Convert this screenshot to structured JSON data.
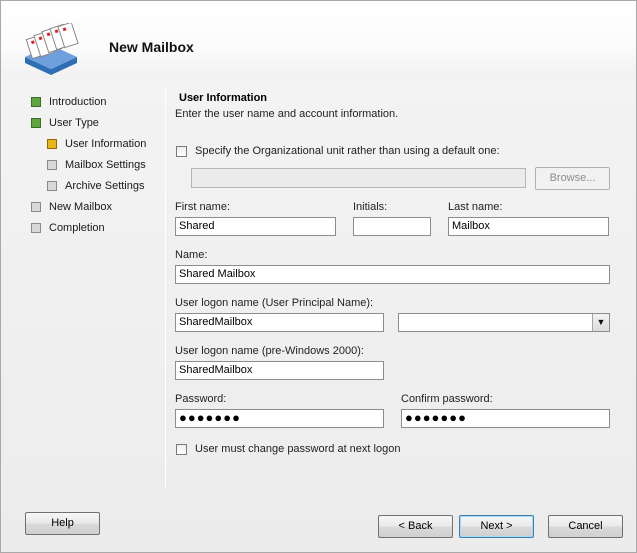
{
  "window": {
    "title": "New Mailbox"
  },
  "nav": {
    "items": [
      {
        "label": "Introduction",
        "state": "done"
      },
      {
        "label": "User Type",
        "state": "done"
      },
      {
        "label": "User Information",
        "state": "current"
      },
      {
        "label": "Mailbox Settings",
        "state": "pending"
      },
      {
        "label": "Archive Settings",
        "state": "pending"
      },
      {
        "label": "New Mailbox",
        "state": "pending"
      },
      {
        "label": "Completion",
        "state": "pending"
      }
    ]
  },
  "colors": {
    "done": "#5ea63d",
    "current": "#e8b51a",
    "pending": "#d8d8d8"
  },
  "main": {
    "title": "User Information",
    "subtitle": "Enter the user name and account information.",
    "ou_checkbox_label": "Specify the Organizational unit rather than using a default one:",
    "ou_checked": false,
    "ou_value": "",
    "browse_label": "Browse...",
    "first_name_label": "First name:",
    "first_name": "Shared",
    "initials_label": "Initials:",
    "initials": "",
    "last_name_label": "Last name:",
    "last_name": "Mailbox",
    "name_label": "Name:",
    "name": "Shared Mailbox",
    "upn_label": "User logon name (User Principal Name):",
    "upn": "SharedMailbox",
    "upn_domain": "",
    "pre2000_label": "User logon name (pre-Windows 2000):",
    "pre2000": "SharedMailbox",
    "password_label": "Password:",
    "password": "●●●●●●●",
    "confirm_label": "Confirm password:",
    "confirm": "●●●●●●●",
    "change_pw_label": "User must change password at next logon",
    "change_pw_checked": false
  },
  "footer": {
    "help": "Help",
    "back": "< Back",
    "next": "Next >",
    "cancel": "Cancel"
  }
}
